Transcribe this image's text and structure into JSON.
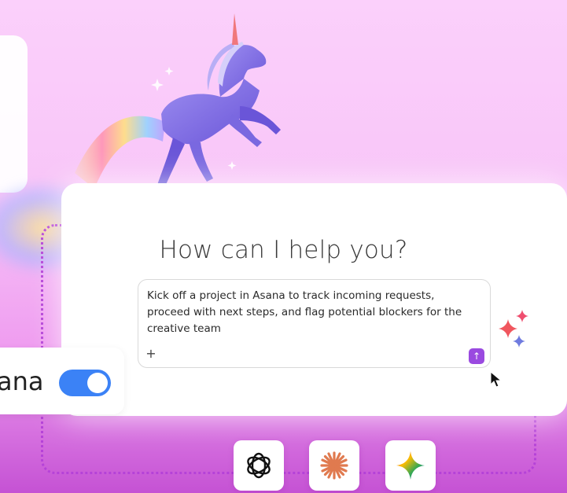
{
  "assistant": {
    "title": "How can I help you?",
    "prompt_text": "Kick off a project in Asana to track incoming requests, proceed with next steps, and flag potential blockers for the creative team",
    "add_icon": "plus-icon",
    "send_icon": "arrow-up-icon",
    "send_color": "#9a4ae0"
  },
  "integration": {
    "label": "ana",
    "toggle_state": "on",
    "toggle_color": "#3b82f6"
  },
  "models": [
    {
      "icon": "openai-icon"
    },
    {
      "icon": "claude-starburst-icon",
      "color": "#e07a4f"
    },
    {
      "icon": "gemini-sparkle-icon"
    }
  ],
  "decor": {
    "mascot": "unicorn-illustration",
    "sparkles_icon": "sparkles-icon",
    "background_colors": [
      "#fbd0fb",
      "#ef9df0",
      "#c552d4"
    ]
  }
}
